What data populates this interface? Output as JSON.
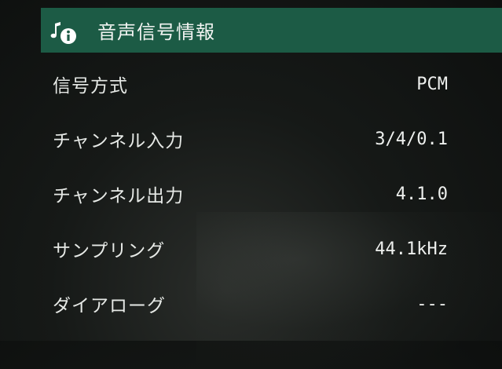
{
  "header": {
    "title": "音声信号情報",
    "icon": "music-info-icon",
    "background_color": "#1c5b45"
  },
  "rows": [
    {
      "label": "信号方式",
      "value": "PCM"
    },
    {
      "label": "チャンネル入力",
      "value": "3/4/0.1"
    },
    {
      "label": "チャンネル出力",
      "value": "4.1.0"
    },
    {
      "label": "サンプリング",
      "value": "44.1kHz"
    },
    {
      "label": "ダイアローグ",
      "value": "---"
    }
  ]
}
